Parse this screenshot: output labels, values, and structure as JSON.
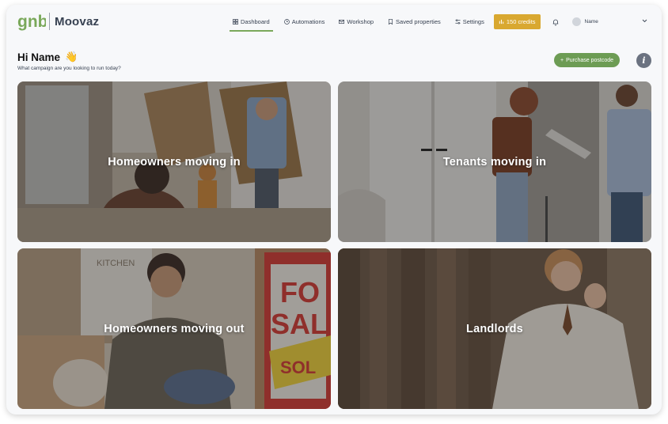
{
  "brand": {
    "logo_text": "Moovaz",
    "logo_mark_color": "#7aa85a"
  },
  "nav": {
    "items": [
      {
        "label": "Dashboard",
        "icon": "grid-icon",
        "active": true
      },
      {
        "label": "Automations",
        "icon": "clock-icon",
        "active": false
      },
      {
        "label": "Workshop",
        "icon": "mail-icon",
        "active": false
      },
      {
        "label": "Saved properties",
        "icon": "bookmark-icon",
        "active": false
      },
      {
        "label": "Settings",
        "icon": "sliders-icon",
        "active": false
      }
    ],
    "credits_label": "150 credits",
    "credits_color": "#d9a830",
    "user_name": "Name"
  },
  "greeting": {
    "title": "Hi Name",
    "emoji": "👋",
    "subtitle": "What campaign are you looking to run today?"
  },
  "actions": {
    "purchase_label": "Purchase postcode",
    "purchase_color": "#6d9c54",
    "info_label": "i"
  },
  "campaigns": [
    {
      "label": "Homeowners moving in"
    },
    {
      "label": "Tenants moving in"
    },
    {
      "label": "Homeowners moving out"
    },
    {
      "label": "Landlords"
    }
  ]
}
